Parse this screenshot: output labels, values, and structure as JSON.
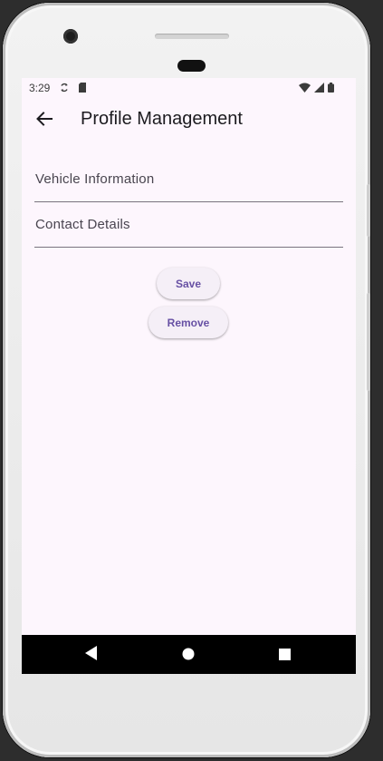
{
  "status_bar": {
    "time": "3:29",
    "left_icons": [
      "sync-icon",
      "sd-card-icon"
    ],
    "right_icons": [
      "wifi-icon",
      "cell-signal-icon",
      "battery-icon"
    ]
  },
  "app_bar": {
    "title": "Profile Management",
    "back_icon": "arrow-back-icon"
  },
  "form": {
    "fields": [
      {
        "label": "Vehicle Information",
        "value": ""
      },
      {
        "label": "Contact Details",
        "value": ""
      }
    ],
    "save_label": "Save",
    "remove_label": "Remove"
  },
  "nav_bar": {
    "icons": [
      "nav-back-icon",
      "nav-home-icon",
      "nav-recents-icon"
    ]
  },
  "colors": {
    "screen_background": "#fdf6fd",
    "button_text": "#6750a4",
    "button_background": "#f5eff7",
    "field_underline": "#79747e"
  }
}
